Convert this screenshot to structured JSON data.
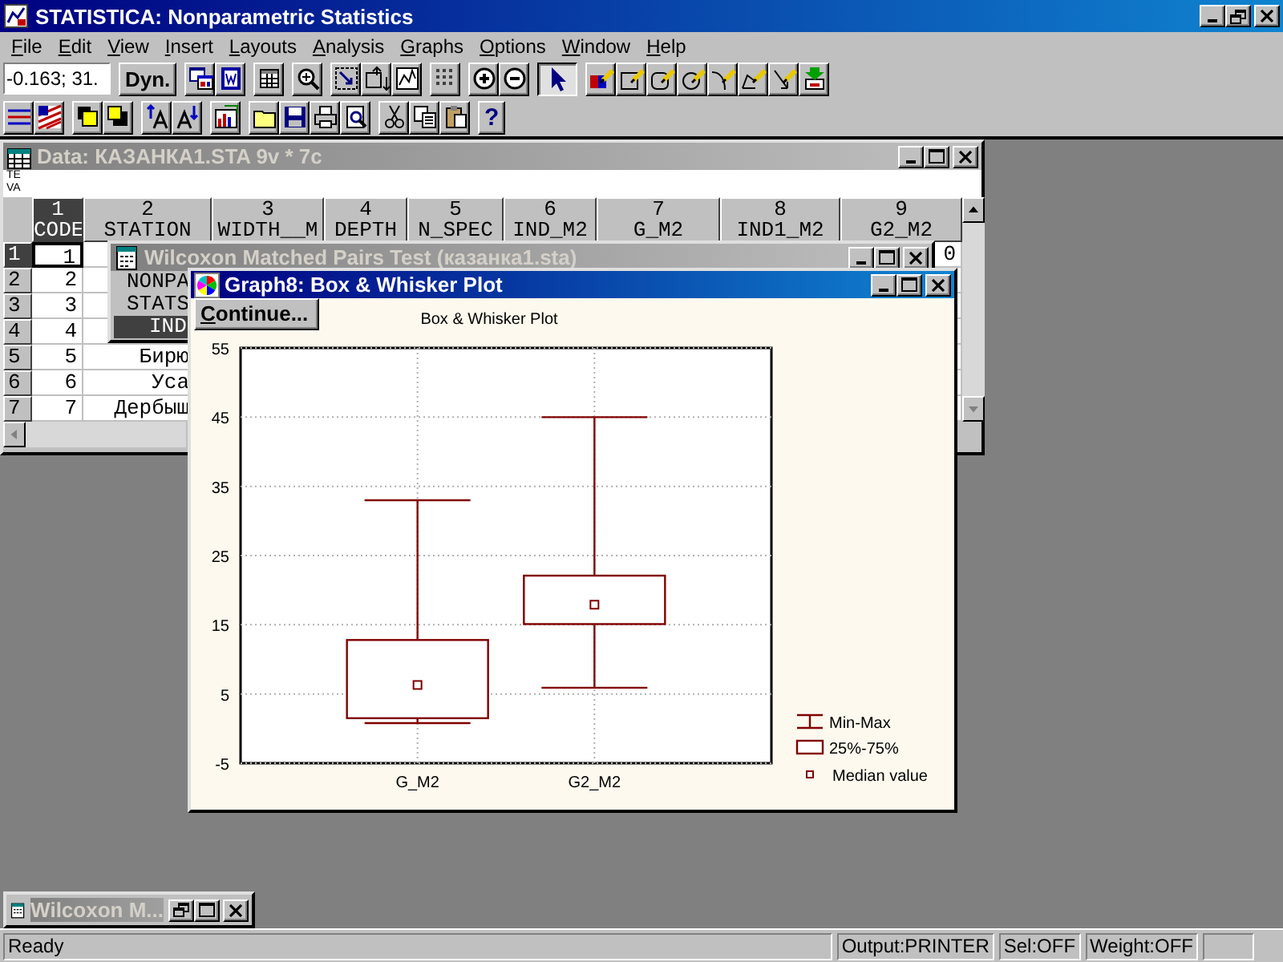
{
  "app_window": {
    "title": "STATISTICA: Nonparametric Statistics"
  },
  "menu": [
    "File",
    "Edit",
    "View",
    "Insert",
    "Layouts",
    "Analysis",
    "Graphs",
    "Options",
    "Window",
    "Help"
  ],
  "toolbars": [
    {
      "groups": [
        [
          {
            "kind": "field",
            "value": "-0.163; 31."
          }
        ],
        [
          {
            "kind": "text",
            "label": "Dyn.",
            "pressed": false
          }
        ],
        [
          {
            "kind": "icon",
            "pressed": false
          },
          {
            "kind": "icon",
            "pressed": false
          }
        ],
        [
          {
            "kind": "icon",
            "pressed": false
          }
        ],
        [
          {
            "kind": "icon",
            "pressed": false
          }
        ],
        [
          {
            "kind": "icon",
            "pressed": false
          },
          {
            "kind": "icon",
            "pressed": false
          },
          {
            "kind": "icon",
            "pressed": false
          }
        ],
        [
          {
            "kind": "icon",
            "pressed": false
          }
        ],
        [
          {
            "kind": "icon",
            "pressed": false
          },
          {
            "kind": "icon",
            "pressed": false
          }
        ],
        [
          {
            "kind": "icon",
            "pressed": true
          }
        ],
        [
          {
            "kind": "icon",
            "pressed": false
          },
          {
            "kind": "icon",
            "pressed": false
          },
          {
            "kind": "icon",
            "pressed": false
          },
          {
            "kind": "icon",
            "pressed": false
          },
          {
            "kind": "icon",
            "pressed": false
          },
          {
            "kind": "icon",
            "pressed": false
          },
          {
            "kind": "icon",
            "pressed": false
          },
          {
            "kind": "icon",
            "pressed": false
          }
        ]
      ]
    },
    {
      "groups": [
        [
          {
            "kind": "icon",
            "pressed": false
          },
          {
            "kind": "icon",
            "pressed": false
          }
        ],
        [
          {
            "kind": "icon",
            "pressed": false
          },
          {
            "kind": "icon",
            "pressed": false
          }
        ],
        [
          {
            "kind": "icon",
            "pressed": false
          },
          {
            "kind": "icon",
            "pressed": false
          }
        ],
        [
          {
            "kind": "icon",
            "pressed": false
          }
        ],
        [
          {
            "kind": "icon",
            "pressed": false
          },
          {
            "kind": "icon",
            "pressed": false
          },
          {
            "kind": "icon",
            "pressed": false
          },
          {
            "kind": "icon",
            "pressed": false
          }
        ],
        [
          {
            "kind": "icon",
            "pressed": false
          },
          {
            "kind": "icon",
            "pressed": false
          },
          {
            "kind": "icon",
            "pressed": false
          }
        ],
        [
          {
            "kind": "text",
            "label": "?",
            "pressed": false
          }
        ]
      ]
    }
  ],
  "data_window": {
    "title": "Data: КАЗАНКА1.STA 9v * 7c",
    "active": false,
    "info_lines": [
      "TE",
      "VA"
    ],
    "columns": [
      {
        "number": "1",
        "name": "CODE",
        "selected": true
      },
      {
        "number": "2",
        "name": "STATION",
        "selected": false
      },
      {
        "number": "3",
        "name": "WIDTH__M",
        "selected": false
      },
      {
        "number": "4",
        "name": "DEPTH",
        "selected": false
      },
      {
        "number": "5",
        "name": "N_SPEC",
        "selected": false
      },
      {
        "number": "6",
        "name": "IND_M2",
        "selected": false
      },
      {
        "number": "7",
        "name": "G_M2",
        "selected": false
      },
      {
        "number": "8",
        "name": "IND1_M2",
        "selected": false
      },
      {
        "number": "9",
        "name": "G2_M2",
        "selected": false
      }
    ],
    "rows": [
      {
        "header": "1",
        "selected": true,
        "code": "1",
        "g2_m2": "0"
      },
      {
        "header": "2",
        "selected": false,
        "code": "2"
      },
      {
        "header": "3",
        "selected": false,
        "code": "3"
      },
      {
        "header": "4",
        "selected": false,
        "code": "4"
      },
      {
        "header": "5",
        "selected": false,
        "code": "5",
        "station": "Бирю"
      },
      {
        "header": "6",
        "selected": false,
        "code": "6",
        "station": "Уса"
      },
      {
        "header": "7",
        "selected": false,
        "code": "7",
        "station": "Дербыш"
      }
    ]
  },
  "wilcoxon_window": {
    "title": "Wilcoxon Matched Pairs Test (казанка1.sta)",
    "active": false,
    "items": [
      {
        "label": "NONPA",
        "selected": false
      },
      {
        "label": "STATS",
        "selected": false
      },
      {
        "label": "IND",
        "selected": true
      }
    ]
  },
  "graph_window": {
    "title": "Graph8: Box & Whisker Plot",
    "active": true,
    "button": "Continue...",
    "chart_data": {
      "type": "box",
      "title": "Box & Whisker Plot",
      "categories": [
        "G_M2",
        "G2_M2"
      ],
      "color": "#800000",
      "ylim": [
        -5,
        55
      ],
      "yticks": [
        -5,
        5,
        15,
        25,
        35,
        45,
        55
      ],
      "grid": true,
      "boxes": [
        {
          "low": 0.8,
          "q1": 1.5,
          "median": 6.3,
          "q3": 12.8,
          "high": 33
        },
        {
          "low": 5.9,
          "q1": 15.1,
          "median": 17.9,
          "q3": 22.1,
          "high": 45
        }
      ]
    },
    "legend": [
      {
        "kind": "whisker",
        "label": "Min-Max"
      },
      {
        "kind": "box",
        "label": "25%-75%"
      },
      {
        "kind": "median",
        "label": "Median value"
      }
    ]
  },
  "minimized_window": {
    "title": "Wilcoxon M..."
  },
  "status_bar": [
    "Ready",
    "Output:PRINTER",
    "Sel:OFF",
    "Weight:OFF"
  ]
}
